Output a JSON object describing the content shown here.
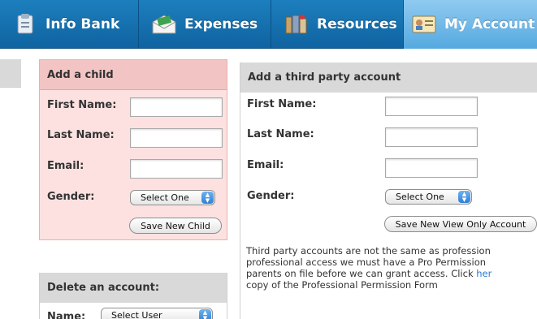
{
  "nav": {
    "tabs": [
      {
        "label": "Info Bank",
        "icon": "info-bank-icon"
      },
      {
        "label": "Expenses",
        "icon": "expenses-icon"
      },
      {
        "label": "Resources",
        "icon": "resources-icon"
      },
      {
        "label": "My Account",
        "icon": "my-account-icon",
        "active": true
      }
    ]
  },
  "add_child": {
    "title": "Add a child",
    "first_name_label": "First Name:",
    "last_name_label": "Last Name:",
    "email_label": "Email:",
    "gender_label": "Gender:",
    "gender_select": "Select One",
    "save_button": "Save New Child"
  },
  "delete_account": {
    "title": "Delete an account:",
    "name_label": "Name:",
    "user_select": "Select User"
  },
  "third_party": {
    "title": "Add a third party account",
    "first_name_label": "First Name:",
    "last_name_label": "Last Name:",
    "email_label": "Email:",
    "gender_label": "Gender:",
    "gender_select": "Select One",
    "save_button": "Save New View Only Account",
    "note_lines": [
      "Third party accounts are not the same as profession",
      "professional access we must have a Pro Permission",
      "parents on file before we can grant access. Click ",
      "copy of the Professional Permission Form"
    ],
    "note_link": "her"
  },
  "colors": {
    "nav_blue": "#1570b0",
    "nav_active": "#6fb8e8",
    "child_panel_bg": "#fde1e1",
    "child_header_bg": "#f2c4c4",
    "header_gray": "#d9d9d9",
    "link": "#2a7bd0"
  }
}
